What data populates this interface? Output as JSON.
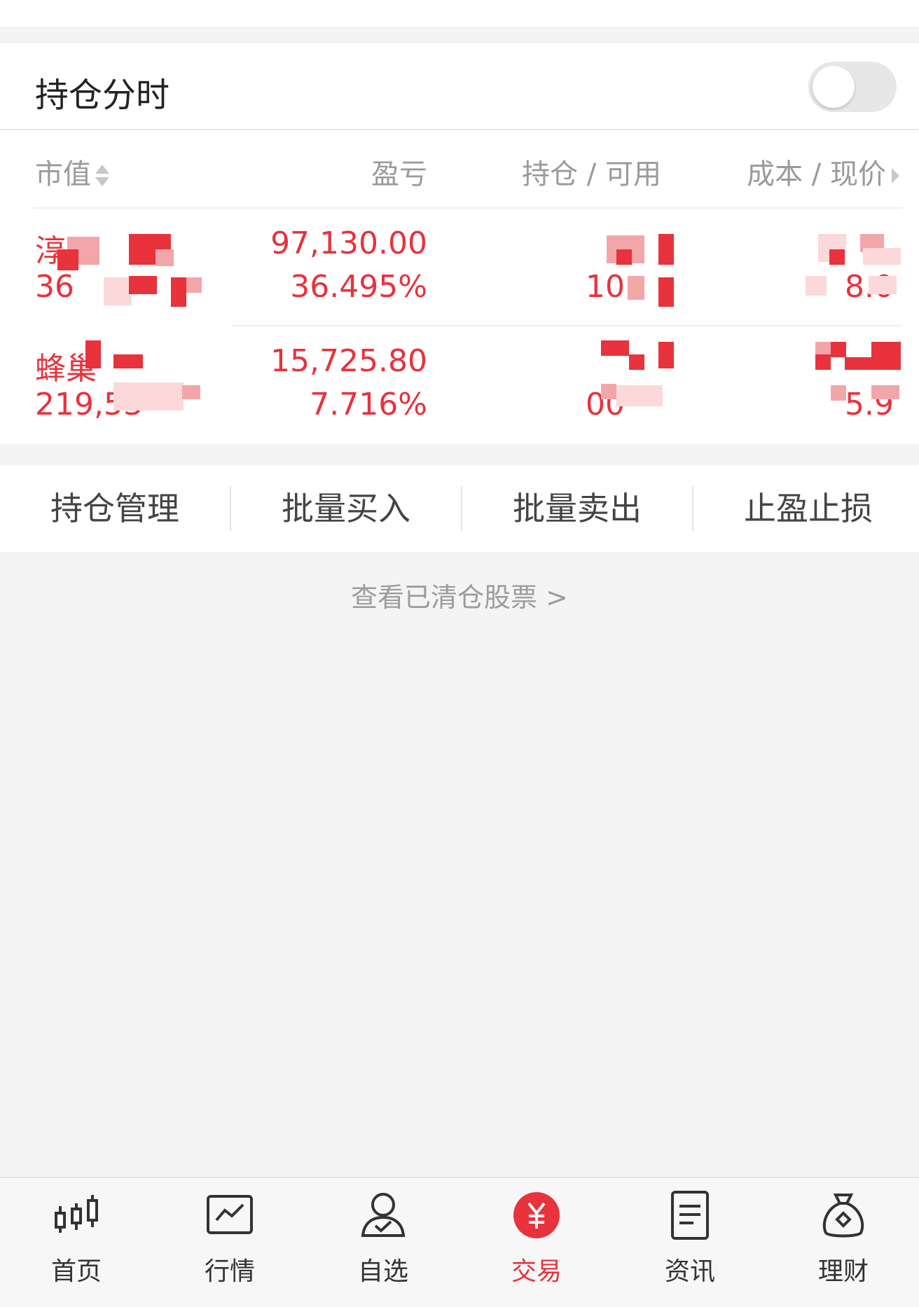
{
  "header": {
    "title": "持仓分时",
    "toggle_on": false
  },
  "columns": {
    "market_value": "市值",
    "profit_loss": "盈亏",
    "position_available": "持仓 / 可用",
    "cost_price": "成本 / 现价"
  },
  "holdings": [
    {
      "name_visible": "淳",
      "market_value_visible": "36",
      "pnl_amount": "97,130.00",
      "pnl_percent": "36.495%",
      "position_visible": "10",
      "cost_price_visible": "8.0"
    },
    {
      "name_visible": "蜂巢",
      "market_value_visible": "219,53",
      "pnl_amount": "15,725.80",
      "pnl_percent": "7.716%",
      "position_visible": "00",
      "cost_price_visible": "5.9"
    }
  ],
  "actions": [
    "持仓管理",
    "批量买入",
    "批量卖出",
    "止盈止损"
  ],
  "cleared_link": "查看已清仓股票 >",
  "tabs": [
    {
      "label": "首页",
      "icon": "candlestick-icon"
    },
    {
      "label": "行情",
      "icon": "chart-icon"
    },
    {
      "label": "自选",
      "icon": "person-check-icon"
    },
    {
      "label": "交易",
      "icon": "yen-icon",
      "active": true
    },
    {
      "label": "资讯",
      "icon": "document-icon"
    },
    {
      "label": "理财",
      "icon": "money-bag-icon"
    }
  ],
  "colors": {
    "accent_red": "#e8323c",
    "background": "#f4f4f4"
  }
}
